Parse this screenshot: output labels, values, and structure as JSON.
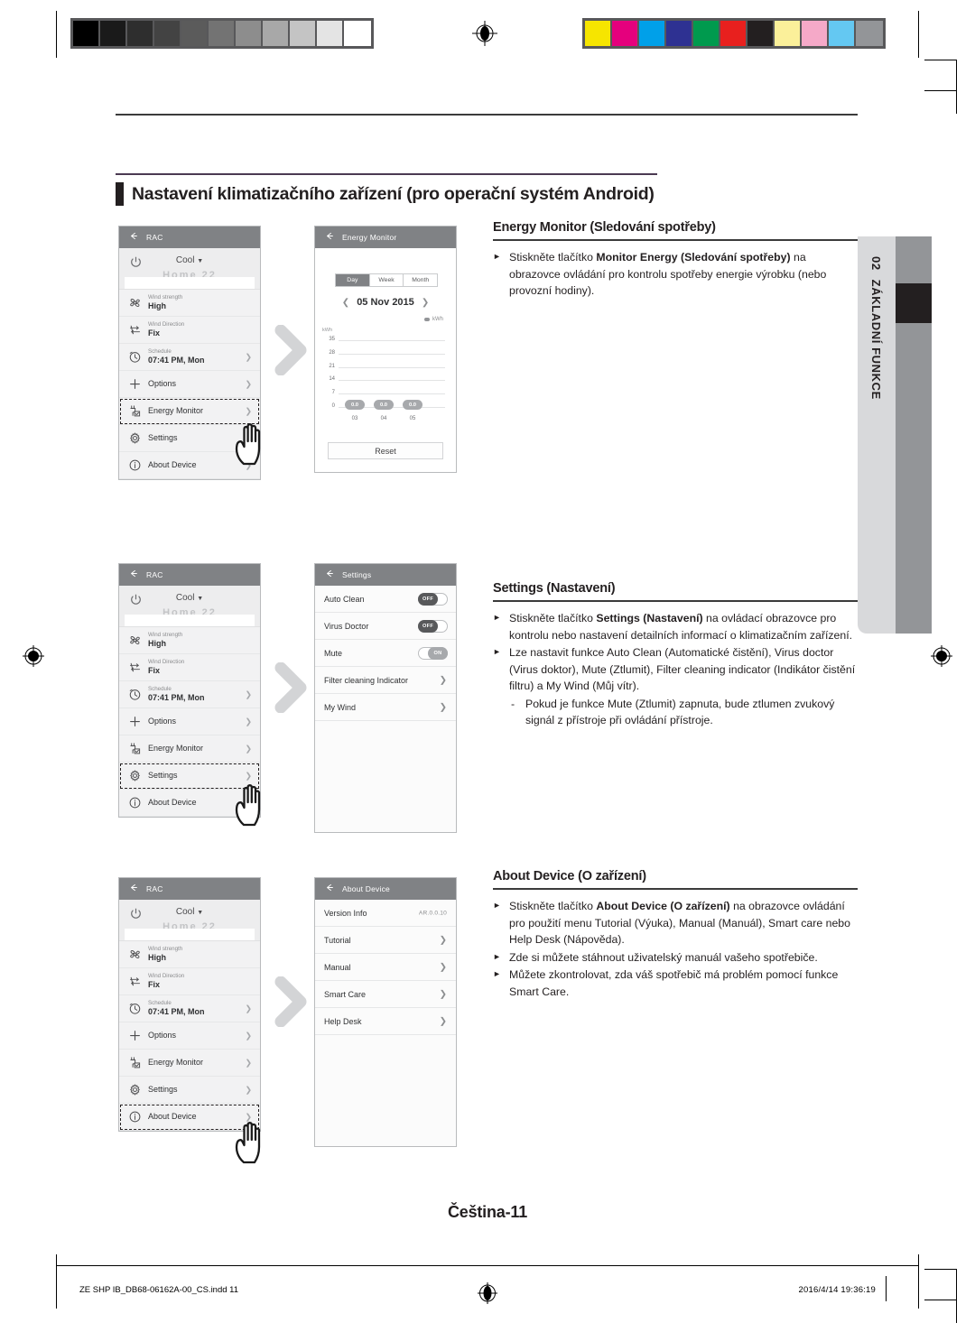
{
  "print_marks": {
    "gray_swatches": [
      "#000000",
      "#1a1a1a",
      "#2e2e2e",
      "#434343",
      "#5b5b5b",
      "#737373",
      "#8d8d8d",
      "#a8a8a8",
      "#c4c4c4",
      "#e4e4e4",
      "#ffffff"
    ],
    "color_swatches": [
      "#f6e500",
      "#e5007d",
      "#00a0e9",
      "#2e3192",
      "#009a4e",
      "#e8201e",
      "#231f20",
      "#fbf09a",
      "#f5a9c8",
      "#64c8f2",
      "#939598"
    ],
    "registration_icon": "registration-target-icon"
  },
  "section": {
    "heading": "Nastavení klimatizačního zařízení (pro operační systém Android)",
    "accent_color": "#4b3a52"
  },
  "thumb_tab": {
    "number": "02",
    "label": "ZÁKLADNÍ FUNKCE"
  },
  "phones": {
    "rac_common": {
      "title": "RAC",
      "back_icon": "back-arrow-icon",
      "power_icon": "power-icon",
      "mode": "Cool",
      "mode_caret_icon": "chevron-down-icon",
      "ghost_label": "Home 22",
      "rows": [
        {
          "icon": "fan-icon",
          "sub": "Wind strength",
          "value": "High",
          "chevron": false
        },
        {
          "icon": "airflow-icon",
          "sub": "Wind Direction",
          "value": "Fix",
          "chevron": false
        },
        {
          "icon": "clock-icon",
          "sub": "Schedule",
          "value": "07:41 PM, Mon",
          "chevron": true
        },
        {
          "icon": "plus-icon",
          "sub": "",
          "value": "Options",
          "chevron": true
        },
        {
          "icon": "energy-icon",
          "sub": "",
          "value": "Energy Monitor",
          "chevron": true
        },
        {
          "icon": "gear-icon",
          "sub": "",
          "value": "Settings",
          "chevron": true
        },
        {
          "icon": "info-icon",
          "sub": "",
          "value": "About Device",
          "chevron": true
        }
      ]
    },
    "energy_monitor": {
      "title": "Energy Monitor",
      "back_icon": "back-arrow-icon",
      "segments": [
        "Day",
        "Week",
        "Month"
      ],
      "active_segment": "Day",
      "date": "05 Nov 2015",
      "prev_icon": "chevron-left-icon",
      "next_icon": "chevron-right-icon",
      "legend": "kWh",
      "reset_label": "Reset"
    },
    "settings": {
      "title": "Settings",
      "back_icon": "back-arrow-icon",
      "rows": [
        {
          "label": "Auto Clean",
          "control": "toggle",
          "state": "OFF"
        },
        {
          "label": "Virus Doctor",
          "control": "toggle",
          "state": "OFF"
        },
        {
          "label": "Mute",
          "control": "toggle",
          "state": "ON"
        },
        {
          "label": "Filter cleaning Indicator",
          "control": "chevron",
          "state": ""
        },
        {
          "label": "My Wind",
          "control": "chevron",
          "state": ""
        }
      ]
    },
    "about_device": {
      "title": "About Device",
      "back_icon": "back-arrow-icon",
      "rows": [
        {
          "label": "Version Info",
          "control": "value",
          "value": "AR.0.0.10"
        },
        {
          "label": "Tutorial",
          "control": "chevron",
          "value": ""
        },
        {
          "label": "Manual",
          "control": "chevron",
          "value": ""
        },
        {
          "label": "Smart Care",
          "control": "chevron",
          "value": ""
        },
        {
          "label": "Help Desk",
          "control": "chevron",
          "value": ""
        }
      ]
    }
  },
  "chart_data": {
    "type": "bar",
    "title": "Energy Monitor",
    "categories": [
      "03",
      "04",
      "05"
    ],
    "values": [
      0.0,
      0.0,
      0.0
    ],
    "data_labels": [
      "0.0",
      "0.0",
      "0.0"
    ],
    "ylabel": "kWh",
    "xlabel": "",
    "yticks": [
      35,
      28,
      21,
      14,
      7,
      0
    ],
    "ylim": [
      0,
      35
    ],
    "grid": true,
    "legend": [
      "kWh"
    ],
    "legend_position": "top-right",
    "annotations": [
      "05 Nov 2015"
    ]
  },
  "sections": [
    {
      "heading": "Energy Monitor (Sledování spotřeby)",
      "bullets": [
        {
          "parts": [
            {
              "t": "Stiskněte tlačítko ",
              "b": false
            },
            {
              "t": "Monitor Energy (Sledování spotřeby)",
              "b": true
            },
            {
              "t": " na obrazovce ovládání pro kontrolu spotřeby energie výrobku (nebo provozní hodiny).",
              "b": false
            }
          ]
        }
      ],
      "dashes": []
    },
    {
      "heading": "Settings (Nastavení)",
      "bullets": [
        {
          "parts": [
            {
              "t": "Stiskněte tlačítko ",
              "b": false
            },
            {
              "t": "Settings (Nastavení)",
              "b": true
            },
            {
              "t": " na ovládací obrazovce pro kontrolu nebo nastavení detailních informací o klimatizačním zařízení.",
              "b": false
            }
          ]
        },
        {
          "parts": [
            {
              "t": "Lze nastavit funkce Auto Clean (Automatické čistění), Virus doctor (Virus doktor), Mute (Ztlumit), Filter cleaning indicator (Indikátor čistění filtru) a My Wind (Můj vítr).",
              "b": false
            }
          ]
        }
      ],
      "dashes": [
        "Pokud je funkce Mute (Ztlumit) zapnuta, bude ztlumen zvukový signál z přístroje při ovládání přístroje."
      ]
    },
    {
      "heading": "About Device (O zařízení)",
      "bullets": [
        {
          "parts": [
            {
              "t": "Stiskněte tlačítko ",
              "b": false
            },
            {
              "t": "About Device (O zařízení)",
              "b": true
            },
            {
              "t": " na obrazovce ovládání pro použití menu Tutorial (Výuka), Manual (Manuál), Smart care nebo Help Desk (Nápověda).",
              "b": false
            }
          ]
        },
        {
          "parts": [
            {
              "t": "Zde si můžete stáhnout uživatelský manuál vašeho spotřebiče.",
              "b": false
            }
          ]
        },
        {
          "parts": [
            {
              "t": "Můžete zkontrolovat, zda váš spotřebič má problém pomocí funkce Smart Care.",
              "b": false
            }
          ]
        }
      ],
      "dashes": []
    }
  ],
  "page_number": "Čeština-11",
  "footer": {
    "left": "ZE SHP IB_DB68-06162A-00_CS.indd   11",
    "right": "2016/4/14   19:36:19",
    "center_icon": "registration-target-icon"
  }
}
